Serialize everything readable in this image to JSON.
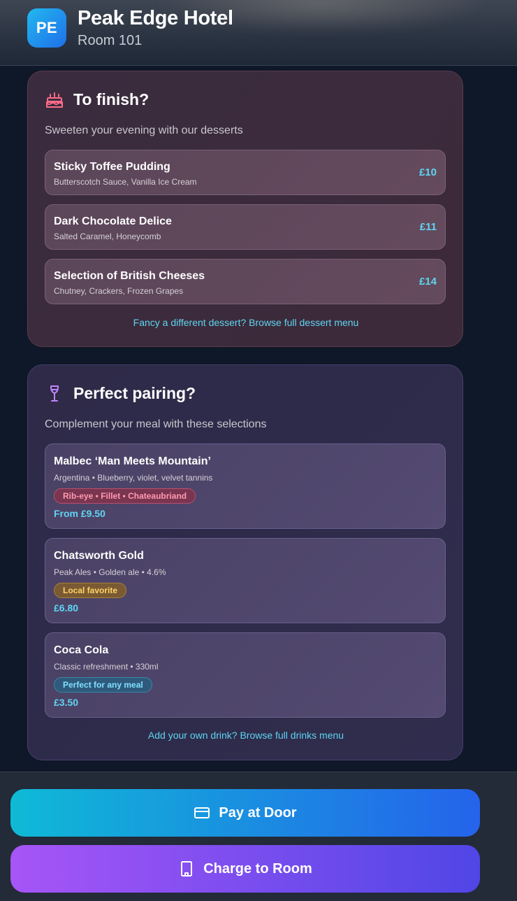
{
  "header": {
    "logo_text": "PE",
    "hotel_name": "Peak Edge Hotel",
    "room": "Room 101"
  },
  "desserts": {
    "icon": "cake-icon",
    "title": "To finish?",
    "subtitle": "Sweeten your evening with our desserts",
    "items": [
      {
        "name": "Sticky Toffee Pudding",
        "desc": "Butterscotch Sauce, Vanilla Ice Cream",
        "price": "£10"
      },
      {
        "name": "Dark Chocolate Delice",
        "desc": "Salted Caramel, Honeycomb",
        "price": "£11"
      },
      {
        "name": "Selection of British Cheeses",
        "desc": "Chutney, Crackers, Frozen Grapes",
        "price": "£14"
      }
    ],
    "link": "Fancy a different dessert? Browse full dessert menu"
  },
  "pairing": {
    "icon": "wine-glass-icon",
    "title": "Perfect pairing?",
    "subtitle": "Complement your meal with these selections",
    "items": [
      {
        "name": "Malbec ‘Man Meets Mountain’",
        "desc": "Argentina • Blueberry, violet, velvet tannins",
        "badge": "Rib-eye • Fillet • Chateaubriand",
        "price": "From £9.50"
      },
      {
        "name": "Chatsworth Gold",
        "desc": "Peak Ales • Golden ale • 4.6%",
        "badge": "Local favorite",
        "price": "£6.80"
      },
      {
        "name": "Coca Cola",
        "desc": "Classic refreshment • 330ml",
        "badge": "Perfect for any meal",
        "price": "£3.50"
      }
    ],
    "link": "Add your own drink? Browse full drinks menu"
  },
  "actions": {
    "pay_at_door": "Pay at Door",
    "charge_to_room": "Charge to Room"
  },
  "colors": {
    "accent_cyan": "#5fd5f2",
    "dessert_icon": "#ff6b8a",
    "wine_icon": "#c084fc"
  }
}
